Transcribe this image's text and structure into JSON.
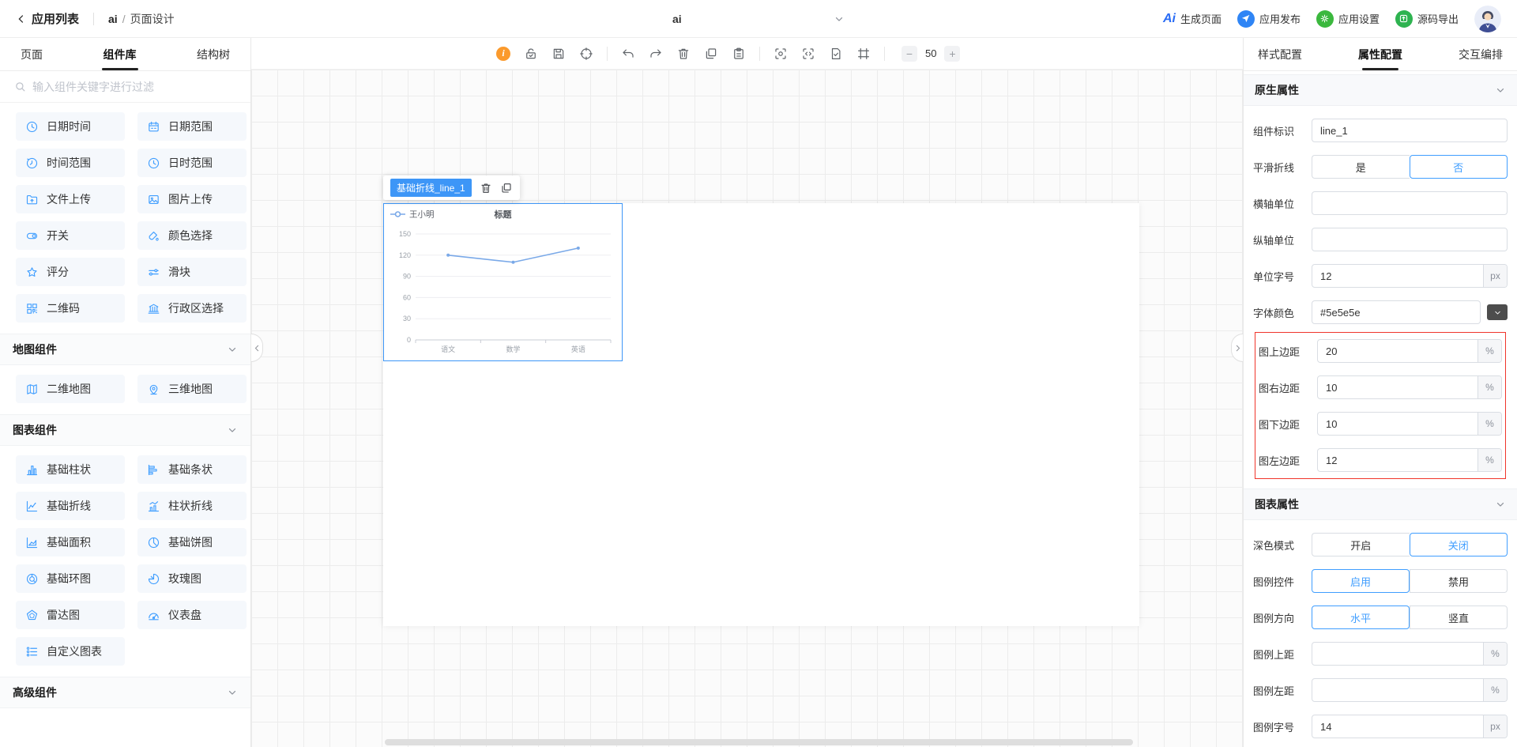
{
  "header": {
    "back_label": "应用列表",
    "breadcrumb": {
      "project": "ai",
      "sep": "/",
      "page": "页面设计"
    },
    "app_selector": {
      "value": "ai"
    },
    "actions": [
      {
        "name": "generate-page",
        "logo": "Ai",
        "label": "生成页面"
      },
      {
        "name": "app-publish",
        "label": "应用发布"
      },
      {
        "name": "app-settings",
        "label": "应用设置"
      },
      {
        "name": "code-export",
        "label": "源码导出"
      }
    ]
  },
  "sidebar": {
    "tabs": [
      {
        "label": "页面",
        "active": false
      },
      {
        "label": "组件库",
        "active": true
      },
      {
        "label": "结构树",
        "active": false
      }
    ],
    "search_placeholder": "输入组件关键字进行过滤",
    "basic_items": [
      {
        "label": "日期时间",
        "icon": "clock"
      },
      {
        "label": "日期范围",
        "icon": "calendar"
      },
      {
        "label": "时间范围",
        "icon": "clock2"
      },
      {
        "label": "日时范围",
        "icon": "clock"
      },
      {
        "label": "文件上传",
        "icon": "folderup"
      },
      {
        "label": "图片上传",
        "icon": "imageup"
      },
      {
        "label": "开关",
        "icon": "switch"
      },
      {
        "label": "颜色选择",
        "icon": "color"
      },
      {
        "label": "评分",
        "icon": "star"
      },
      {
        "label": "滑块",
        "icon": "slider"
      },
      {
        "label": "二维码",
        "icon": "qrcode"
      },
      {
        "label": "行政区选择",
        "icon": "district"
      }
    ],
    "sections": [
      {
        "title": "地图组件",
        "items": [
          {
            "label": "二维地图",
            "icon": "map2d"
          },
          {
            "label": "三维地图",
            "icon": "map3d"
          }
        ]
      },
      {
        "title": "图表组件",
        "items": [
          {
            "label": "基础柱状",
            "icon": "cbar"
          },
          {
            "label": "基础条状",
            "icon": "chbar"
          },
          {
            "label": "基础折线",
            "icon": "cline"
          },
          {
            "label": "柱状折线",
            "icon": "cbarline"
          },
          {
            "label": "基础面积",
            "icon": "carea"
          },
          {
            "label": "基础饼图",
            "icon": "cpie"
          },
          {
            "label": "基础环图",
            "icon": "cdonut"
          },
          {
            "label": "玫瑰图",
            "icon": "crose"
          },
          {
            "label": "雷达图",
            "icon": "cradar"
          },
          {
            "label": "仪表盘",
            "icon": "cgauge"
          },
          {
            "label": "自定义图表",
            "icon": "ccustom"
          }
        ]
      },
      {
        "title": "高级组件",
        "items": []
      }
    ]
  },
  "toolbar": {
    "zoom_value": "50",
    "zoom_out": "−",
    "zoom_in": "+"
  },
  "canvas": {
    "component_label": "基础折线_line_1"
  },
  "chart_data": {
    "type": "line",
    "title": "标题",
    "categories": [
      "语文",
      "数学",
      "英语"
    ],
    "series": [
      {
        "name": "王小明",
        "values": [
          120,
          110,
          130
        ]
      }
    ],
    "ylim": [
      0,
      150
    ],
    "yticks": [
      0,
      30,
      60,
      90,
      120,
      150
    ],
    "legend_position": "top-left",
    "grid": true,
    "line_color": "#7aa9e8",
    "smooth": false
  },
  "inspector": {
    "tabs": [
      {
        "label": "样式配置",
        "active": false
      },
      {
        "label": "属性配置",
        "active": true
      },
      {
        "label": "交互编排",
        "active": false
      }
    ],
    "sections": [
      {
        "title": "原生属性",
        "fields": [
          {
            "name": "component-id",
            "label": "组件标识",
            "type": "text",
            "value": "line_1"
          },
          {
            "name": "smooth-line",
            "label": "平滑折线",
            "type": "toggle",
            "options": [
              "是",
              "否"
            ],
            "selected": "否"
          },
          {
            "name": "x-axis-unit",
            "label": "横轴单位",
            "type": "text",
            "value": ""
          },
          {
            "name": "y-axis-unit",
            "label": "纵轴单位",
            "type": "text",
            "value": ""
          },
          {
            "name": "unit-font-size",
            "label": "单位字号",
            "type": "text",
            "value": "12",
            "unit": "px"
          },
          {
            "name": "font-color",
            "label": "字体颜色",
            "type": "color",
            "value": "#5e5e5e"
          },
          {
            "name": "chart-margin-top",
            "label": "图上边距",
            "type": "text",
            "value": "20",
            "unit": "%",
            "highlight": true
          },
          {
            "name": "chart-margin-right",
            "label": "图右边距",
            "type": "text",
            "value": "10",
            "unit": "%",
            "highlight": true
          },
          {
            "name": "chart-margin-bottom",
            "label": "图下边距",
            "type": "text",
            "value": "10",
            "unit": "%",
            "highlight": true
          },
          {
            "name": "chart-margin-left",
            "label": "图左边距",
            "type": "text",
            "value": "12",
            "unit": "%",
            "highlight": true
          }
        ]
      },
      {
        "title": "图表属性",
        "fields": [
          {
            "name": "dark-mode",
            "label": "深色模式",
            "type": "toggle",
            "options": [
              "开启",
              "关闭"
            ],
            "selected": "关闭"
          },
          {
            "name": "legend-control",
            "label": "图例控件",
            "type": "toggle",
            "options": [
              "启用",
              "禁用"
            ],
            "selected": "启用"
          },
          {
            "name": "legend-direction",
            "label": "图例方向",
            "type": "toggle",
            "options": [
              "水平",
              "竖直"
            ],
            "selected": "水平"
          },
          {
            "name": "legend-top",
            "label": "图例上距",
            "type": "text",
            "value": "",
            "unit": "%"
          },
          {
            "name": "legend-left",
            "label": "图例左距",
            "type": "text",
            "value": "",
            "unit": "%"
          },
          {
            "name": "legend-font-size",
            "label": "图例字号",
            "type": "text",
            "value": "14",
            "unit": "px"
          }
        ]
      }
    ]
  }
}
